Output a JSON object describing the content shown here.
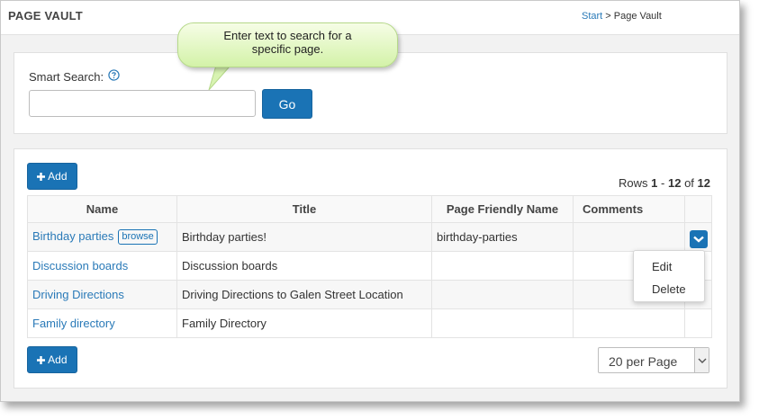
{
  "header": {
    "title": "PAGE VAULT",
    "breadcrumb": {
      "start": "Start",
      "separator": ">",
      "current": "Page Vault"
    }
  },
  "callout": {
    "text_line1": "Enter text to search for a",
    "text_line2": "specific page."
  },
  "search": {
    "label": "Smart Search:",
    "help_icon": "question-circle-icon",
    "value": "",
    "placeholder": "",
    "go_label": "Go"
  },
  "toolbar": {
    "add_label": "Add",
    "add_icon": "plus-icon"
  },
  "rows_info": {
    "prefix": "Rows",
    "from": "1",
    "dash": "-",
    "to": "12",
    "of": "of",
    "total": "12"
  },
  "table": {
    "columns": [
      "Name",
      "Title",
      "Page Friendly Name",
      "Comments"
    ],
    "rows": [
      {
        "name": "Birthday parties",
        "badge": "browse",
        "title": "Birthday parties!",
        "friendly": "birthday-parties",
        "comments": ""
      },
      {
        "name": "Discussion boards",
        "title": "Discussion boards",
        "friendly": "",
        "comments": ""
      },
      {
        "name": "Driving Directions",
        "title": "Driving Directions to Galen Street Location",
        "friendly": "",
        "comments": ""
      },
      {
        "name": "Family directory",
        "title": "Family Directory",
        "friendly": "",
        "comments": ""
      }
    ]
  },
  "row_menu": {
    "items": [
      "Edit",
      "Delete"
    ],
    "toggle_icon": "chevron-down-icon"
  },
  "pagination": {
    "per_page": "20 per Page"
  },
  "colors": {
    "primary": "#1a73b5",
    "link": "#2a7ab8",
    "callout": "#d3f2a8"
  }
}
